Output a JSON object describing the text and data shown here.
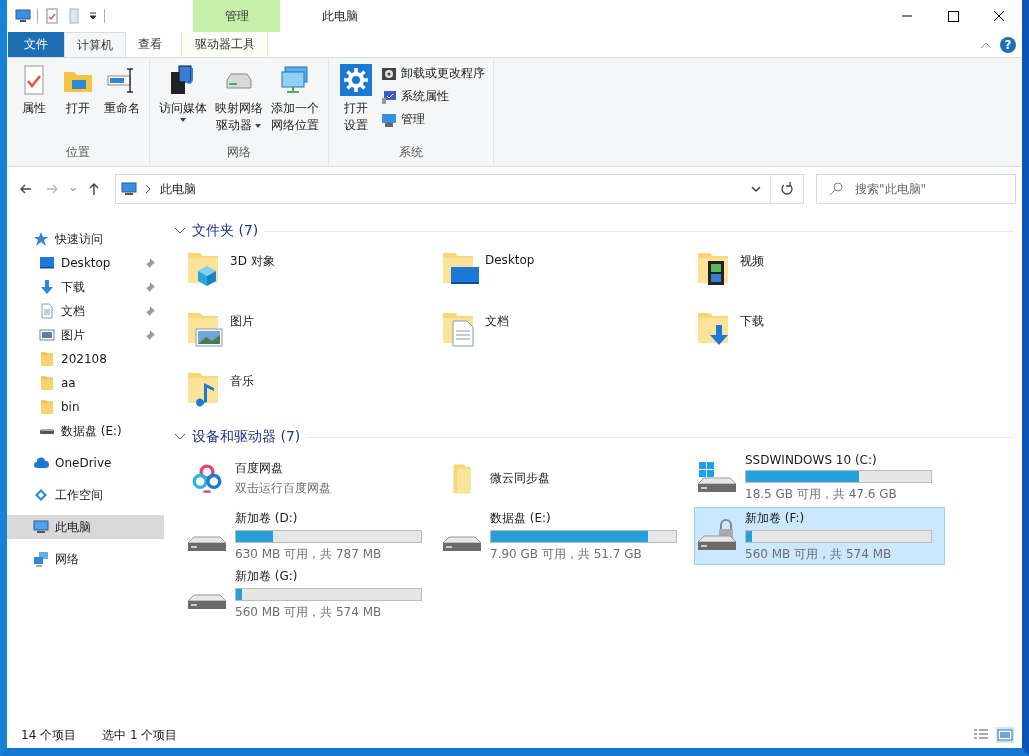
{
  "window": {
    "title": "此电脑",
    "context_group": "管理"
  },
  "tabs": [
    {
      "label": "文件",
      "kind": "file",
      "selected": false
    },
    {
      "label": "计算机",
      "kind": "tab",
      "selected": true
    },
    {
      "label": "查看",
      "kind": "tab",
      "selected": false
    },
    {
      "label": "驱动器工具",
      "kind": "context",
      "selected": false
    }
  ],
  "help": "?",
  "ribbon_groups": [
    {
      "label": "位置",
      "buttons": [
        {
          "kind": "large",
          "lines": [
            "属性"
          ],
          "dropdown": false
        },
        {
          "kind": "large",
          "lines": [
            "打开"
          ],
          "dropdown": false
        },
        {
          "kind": "large",
          "lines": [
            "重命名"
          ],
          "dropdown": false
        }
      ]
    },
    {
      "label": "网络",
      "buttons": [
        {
          "kind": "large",
          "lines": [
            "访问媒体"
          ],
          "dropdown": true
        },
        {
          "kind": "large",
          "lines": [
            "映射网络",
            "驱动器"
          ],
          "dropdown": true
        },
        {
          "kind": "large",
          "lines": [
            "添加一个",
            "网络位置"
          ],
          "dropdown": false
        }
      ]
    },
    {
      "label": "系统",
      "buttons": [
        {
          "kind": "large",
          "lines": [
            "打开",
            "设置"
          ],
          "dropdown": false
        },
        {
          "kind": "small",
          "lines": [
            "卸载或更改程序"
          ],
          "dropdown": false
        },
        {
          "kind": "small",
          "lines": [
            "系统属性"
          ],
          "dropdown": false
        },
        {
          "kind": "small",
          "lines": [
            "管理"
          ],
          "dropdown": false
        }
      ]
    }
  ],
  "nav": [
    {
      "kind": "back",
      "disabled": false
    },
    {
      "kind": "forward",
      "disabled": true
    },
    {
      "kind": "recent",
      "disabled": false
    },
    {
      "kind": "up",
      "disabled": false
    }
  ],
  "address": {
    "path": [
      "此电脑"
    ]
  },
  "search": {
    "placeholder": "搜索\"此电脑\""
  },
  "sidebar": {
    "items": [
      {
        "label": "快速访问",
        "selected": false,
        "children": [
          {
            "label": "Desktop",
            "pinned": true,
            "selected": false
          },
          {
            "label": "下载",
            "pinned": true,
            "selected": false
          },
          {
            "label": "文档",
            "pinned": true,
            "selected": false
          },
          {
            "label": "图片",
            "pinned": true,
            "selected": false
          },
          {
            "label": "202108",
            "pinned": false,
            "selected": false
          },
          {
            "label": "aa",
            "pinned": false,
            "selected": false
          },
          {
            "label": "bin",
            "pinned": false,
            "selected": false
          },
          {
            "label": "数据盘 (E:)",
            "pinned": false,
            "selected": false
          }
        ]
      },
      {
        "label": "OneDrive",
        "selected": false
      },
      {
        "label": "工作空间",
        "selected": false
      },
      {
        "label": "此电脑",
        "selected": true
      },
      {
        "label": "网络",
        "selected": false
      }
    ]
  },
  "sections": [
    {
      "title": "文件夹 (7)",
      "kind": "folders",
      "expanded": true,
      "items": [
        {
          "name": "3D 对象"
        },
        {
          "name": "Desktop"
        },
        {
          "name": "视频"
        },
        {
          "name": "图片"
        },
        {
          "name": "文档"
        },
        {
          "name": "下载"
        },
        {
          "name": "音乐"
        }
      ]
    },
    {
      "title": "设备和驱动器 (7)",
      "kind": "devices",
      "expanded": true,
      "items": [
        {
          "kind": "app",
          "name": "百度网盘",
          "subtitle": "双击运行百度网盘",
          "selected": false
        },
        {
          "kind": "folder",
          "name": "微云同步盘",
          "selected": false
        },
        {
          "kind": "drive",
          "name": "SSDWINDOWS 10 (C:)",
          "level": 0.61,
          "reading": "18.5 GB 可用，共 47.6 GB",
          "selected": false
        },
        {
          "kind": "drive",
          "name": "新加卷 (D:)",
          "level": 0.2,
          "reading": "630 MB 可用，共 787 MB",
          "selected": false
        },
        {
          "kind": "drive",
          "name": "数据盘 (E:)",
          "level": 0.85,
          "reading": "7.90 GB 可用，共 51.7 GB",
          "selected": false
        },
        {
          "kind": "drive",
          "name": "新加卷 (F:)",
          "level": 0.03,
          "reading": "560 MB 可用，共 574 MB",
          "selected": true
        },
        {
          "kind": "drive",
          "name": "新加卷 (G:)",
          "level": 0.03,
          "reading": "560 MB 可用，共 574 MB",
          "selected": false
        }
      ]
    }
  ],
  "status_bar": {
    "items": [
      "14 个项目",
      "选中 1 个项目"
    ],
    "views": [
      {
        "kind": "details",
        "selected": false
      },
      {
        "kind": "large_icons",
        "selected": true
      }
    ]
  }
}
